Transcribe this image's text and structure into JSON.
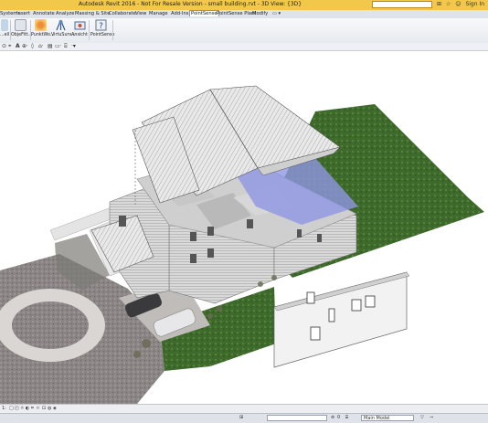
{
  "titlebar": {
    "title": "Autodesk Revit 2016 - Not For Resale Version -     small building.rvt - 3D View: {3D}",
    "search_placeholder": "Type a keyword or phrase",
    "sign_in": "Sign In"
  },
  "menu": {
    "items": [
      "Systems",
      "Insert",
      "Annotate",
      "Analyze",
      "Massing & Site",
      "Collaborate",
      "View",
      "Manage",
      "Add-Ins",
      "PointSense",
      "PointSense Plant",
      "Modify"
    ],
    "active": "PointSense"
  },
  "ribbon": {
    "buttons": [
      "...ell",
      "ObjeFitt...",
      "PunktWo...",
      "VirtuSurv...",
      "Ansicht",
      "PointSense"
    ]
  },
  "statusbar": {
    "model": "Main Model",
    "zero": "0"
  },
  "colors": {
    "titlebar": "#f2c84a",
    "ribbon": "#eef0f3",
    "grass": "#3f6b2e"
  }
}
